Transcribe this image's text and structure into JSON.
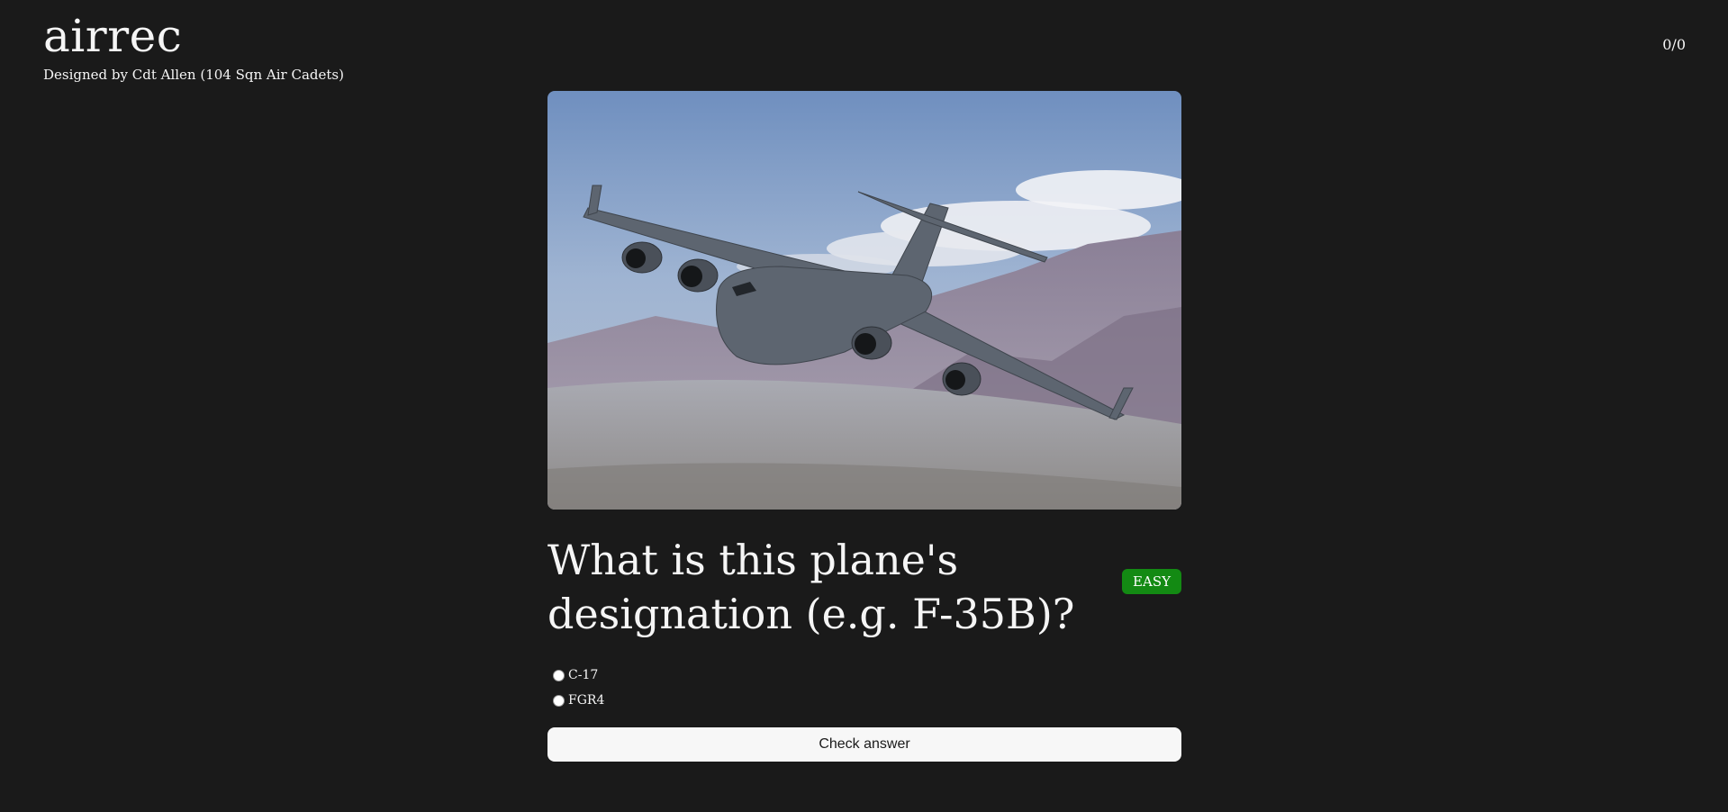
{
  "header": {
    "title": "airrec",
    "subtitle": "Designed by Cdt Allen (104 Sqn Air Cadets)",
    "score": "0/0"
  },
  "quiz": {
    "image_subject": "C-17 transport aircraft flying over mountains",
    "question": "What is this plane's designation (e.g. F-35B)?",
    "difficulty": "EASY",
    "difficulty_color": "#138a13",
    "options": [
      {
        "label": "C-17"
      },
      {
        "label": "FGR4"
      }
    ],
    "check_label": "Check answer"
  }
}
